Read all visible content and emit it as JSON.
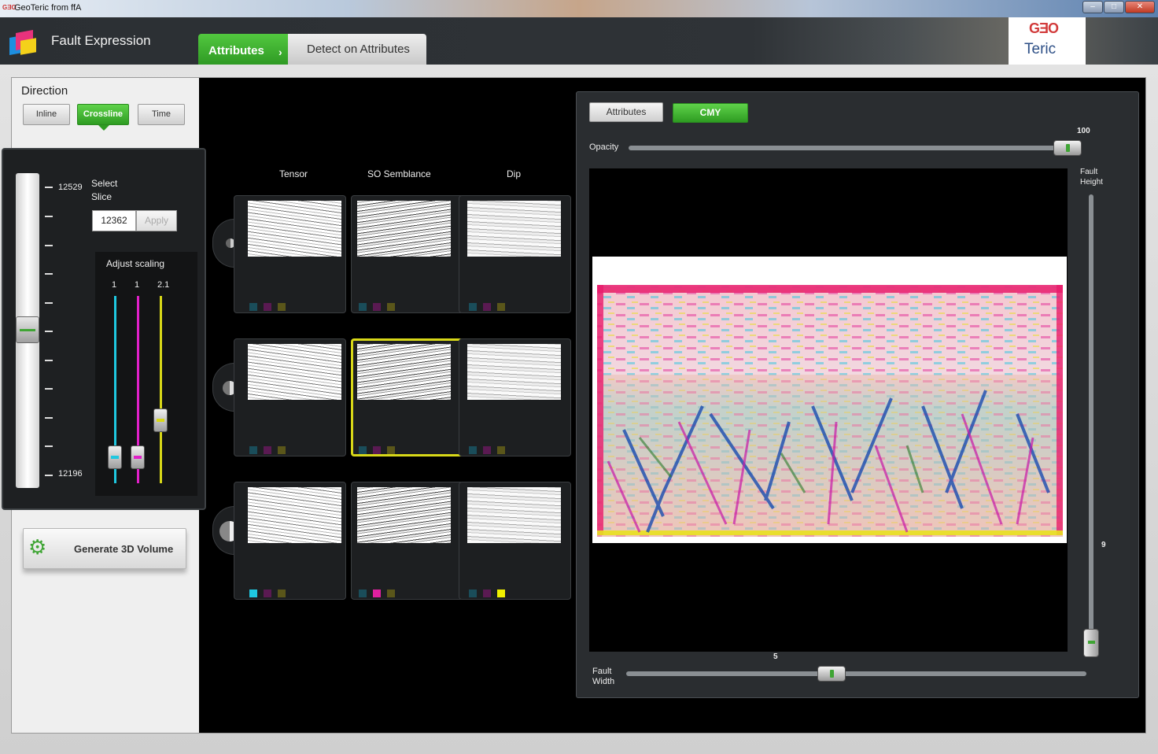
{
  "window": {
    "title": "GeoTeric from ffA"
  },
  "app": {
    "title": "Fault Expression",
    "logo_top": "GƎO",
    "logo_bottom": "Teric"
  },
  "tabs": [
    {
      "label": "Attributes"
    },
    {
      "label": "Detect on Attributes"
    }
  ],
  "direction": {
    "heading": "Direction",
    "buttons": [
      {
        "label": "Inline"
      },
      {
        "label": "Crossline"
      },
      {
        "label": "Time"
      }
    ]
  },
  "slice": {
    "max_label": "12529",
    "min_label": "12196",
    "select_label_1": "Select",
    "select_label_2": "Slice",
    "value": "12362",
    "apply_label": "Apply"
  },
  "scaling": {
    "heading": "Adjust scaling",
    "values": [
      "1",
      "1",
      "2.1"
    ],
    "colors": [
      "#1fc8e0",
      "#e020c8",
      "#d8d818"
    ],
    "levels": [
      0.1,
      0.1,
      0.3
    ]
  },
  "generate": {
    "label": "Generate 3D Volume"
  },
  "columns": [
    "Tensor",
    "SO Semblance",
    "Dip"
  ],
  "cmy": {
    "tabs": [
      {
        "label": "Attributes"
      },
      {
        "label": "CMY"
      }
    ],
    "opacity_label": "Opacity",
    "opacity_value": "100",
    "fault_height_label_1": "Fault",
    "fault_height_label_2": "Height",
    "fault_height_value": "9",
    "fault_width_label_1": "Fault",
    "fault_width_label_2": "Width",
    "fault_width_value": "5"
  },
  "colors": {
    "accent_green": "#3cb62c",
    "cyan": "#1fc8e0",
    "magenta": "#e020c8",
    "yellow": "#e8e800"
  }
}
